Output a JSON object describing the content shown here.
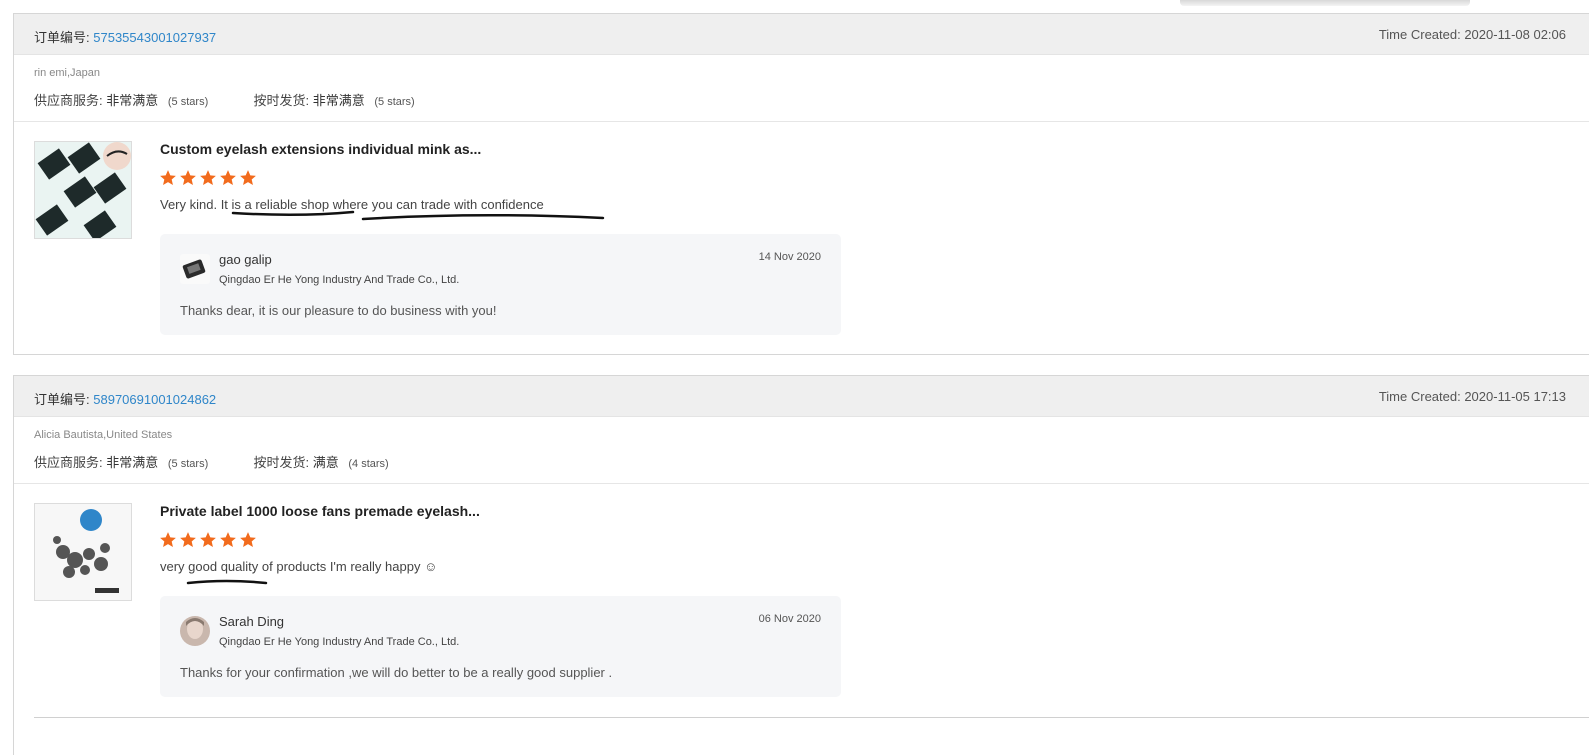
{
  "colors": {
    "link": "#2f86c9",
    "star": "#f26b1d",
    "header_bg": "#efefef"
  },
  "orders": [
    {
      "order_label": "订单编号:",
      "order_number": "57535543001027937",
      "time_created": "Time Created: 2020-11-08 02:06",
      "buyer": "rin emi,Japan",
      "supplier_service_label": "供应商服务:",
      "supplier_service_value": "非常满意",
      "supplier_service_stars": "(5 stars)",
      "ontime_label": "按时发货:",
      "ontime_value": "非常满意",
      "ontime_stars": "(5 stars)",
      "product_title": "Custom eyelash extensions individual mink as...",
      "rating": 5,
      "review": "Very kind.  It is a reliable shop where you can trade with confidence",
      "reply": {
        "name": "gao galip",
        "company": "Qingdao Er He Yong Industry And Trade Co., Ltd.",
        "date": "14 Nov 2020",
        "message": "Thanks dear, it is our pleasure to do business with you!"
      }
    },
    {
      "order_label": "订单编号:",
      "order_number": "58970691001024862",
      "time_created": "Time Created: 2020-11-05 17:13",
      "buyer": "Alicia Bautista,United States",
      "supplier_service_label": "供应商服务:",
      "supplier_service_value": "非常满意",
      "supplier_service_stars": "(5 stars)",
      "ontime_label": "按时发货:",
      "ontime_value": "满意",
      "ontime_stars": "(4 stars)",
      "product_title": "Private label 1000 loose fans premade eyelash...",
      "rating": 5,
      "review": "very good quality of products I'm really happy ☺",
      "reply": {
        "name": "Sarah Ding",
        "company": "Qingdao Er He Yong Industry And Trade Co., Ltd.",
        "date": "06 Nov 2020",
        "message": "Thanks for your confirmation ,we will do better to be a really good supplier ."
      }
    }
  ]
}
